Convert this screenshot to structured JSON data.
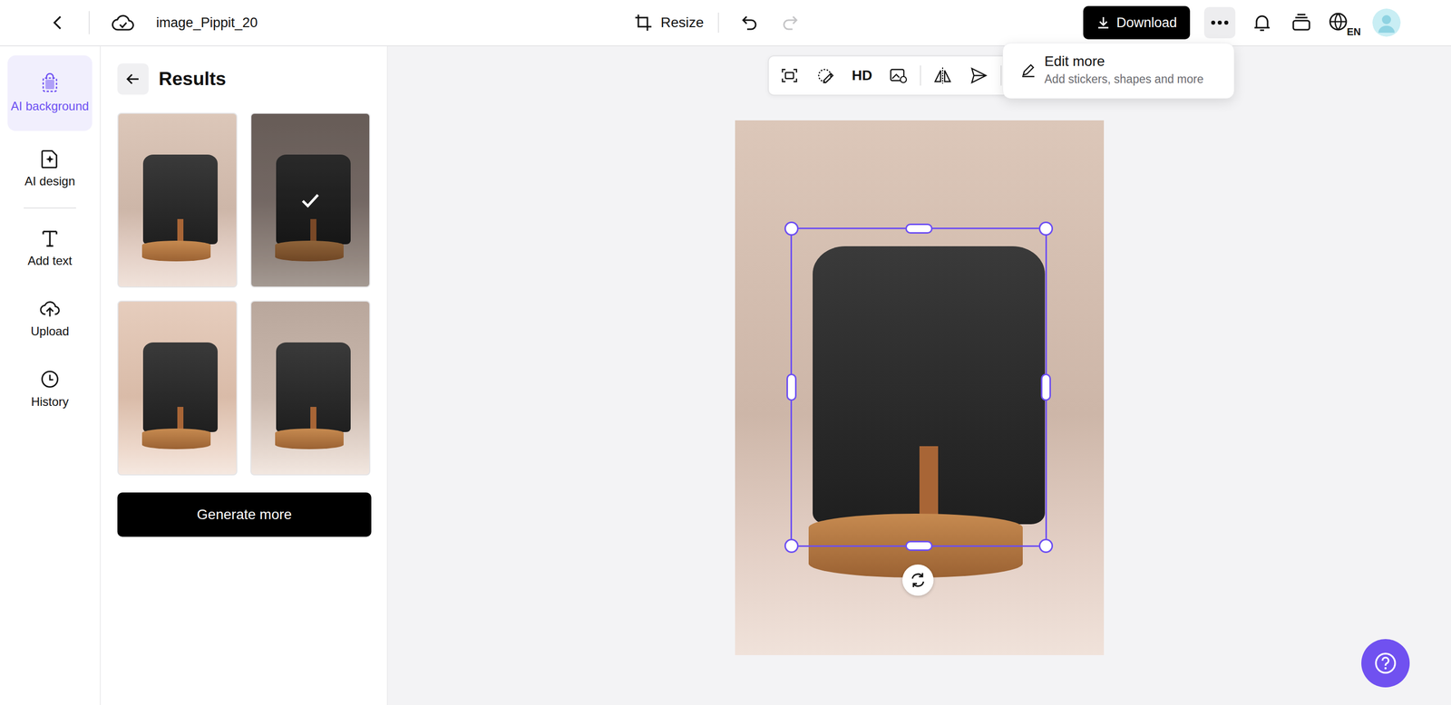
{
  "topbar": {
    "title": "image_Pippit_20",
    "resize": "Resize",
    "download": "Download",
    "language": "EN",
    "history": [
      {
        "name": "undo",
        "disabled": false
      },
      {
        "name": "redo",
        "disabled": true
      }
    ]
  },
  "sidebar": {
    "items": [
      {
        "label": "AI background",
        "selected": true
      },
      {
        "label": "AI design",
        "selected": false
      },
      {
        "label": "Add text",
        "selected": false
      },
      {
        "label": "Upload",
        "selected": false
      },
      {
        "label": "History",
        "selected": false
      }
    ]
  },
  "panel": {
    "title": "Results",
    "results": [
      {
        "selected": false
      },
      {
        "selected": true
      },
      {
        "selected": false
      },
      {
        "selected": false
      }
    ],
    "button": "Generate more"
  },
  "toolbar": {
    "items": [
      {
        "kind": "icon"
      },
      {
        "kind": "icon"
      },
      {
        "kind": "text",
        "label": "HD"
      },
      {
        "kind": "icon"
      },
      {
        "kind": "icon"
      },
      {
        "kind": "icon"
      }
    ]
  },
  "menu": {
    "items": [
      {
        "label": "Edit more",
        "description": "Add stickers, shapes and more"
      }
    ]
  }
}
